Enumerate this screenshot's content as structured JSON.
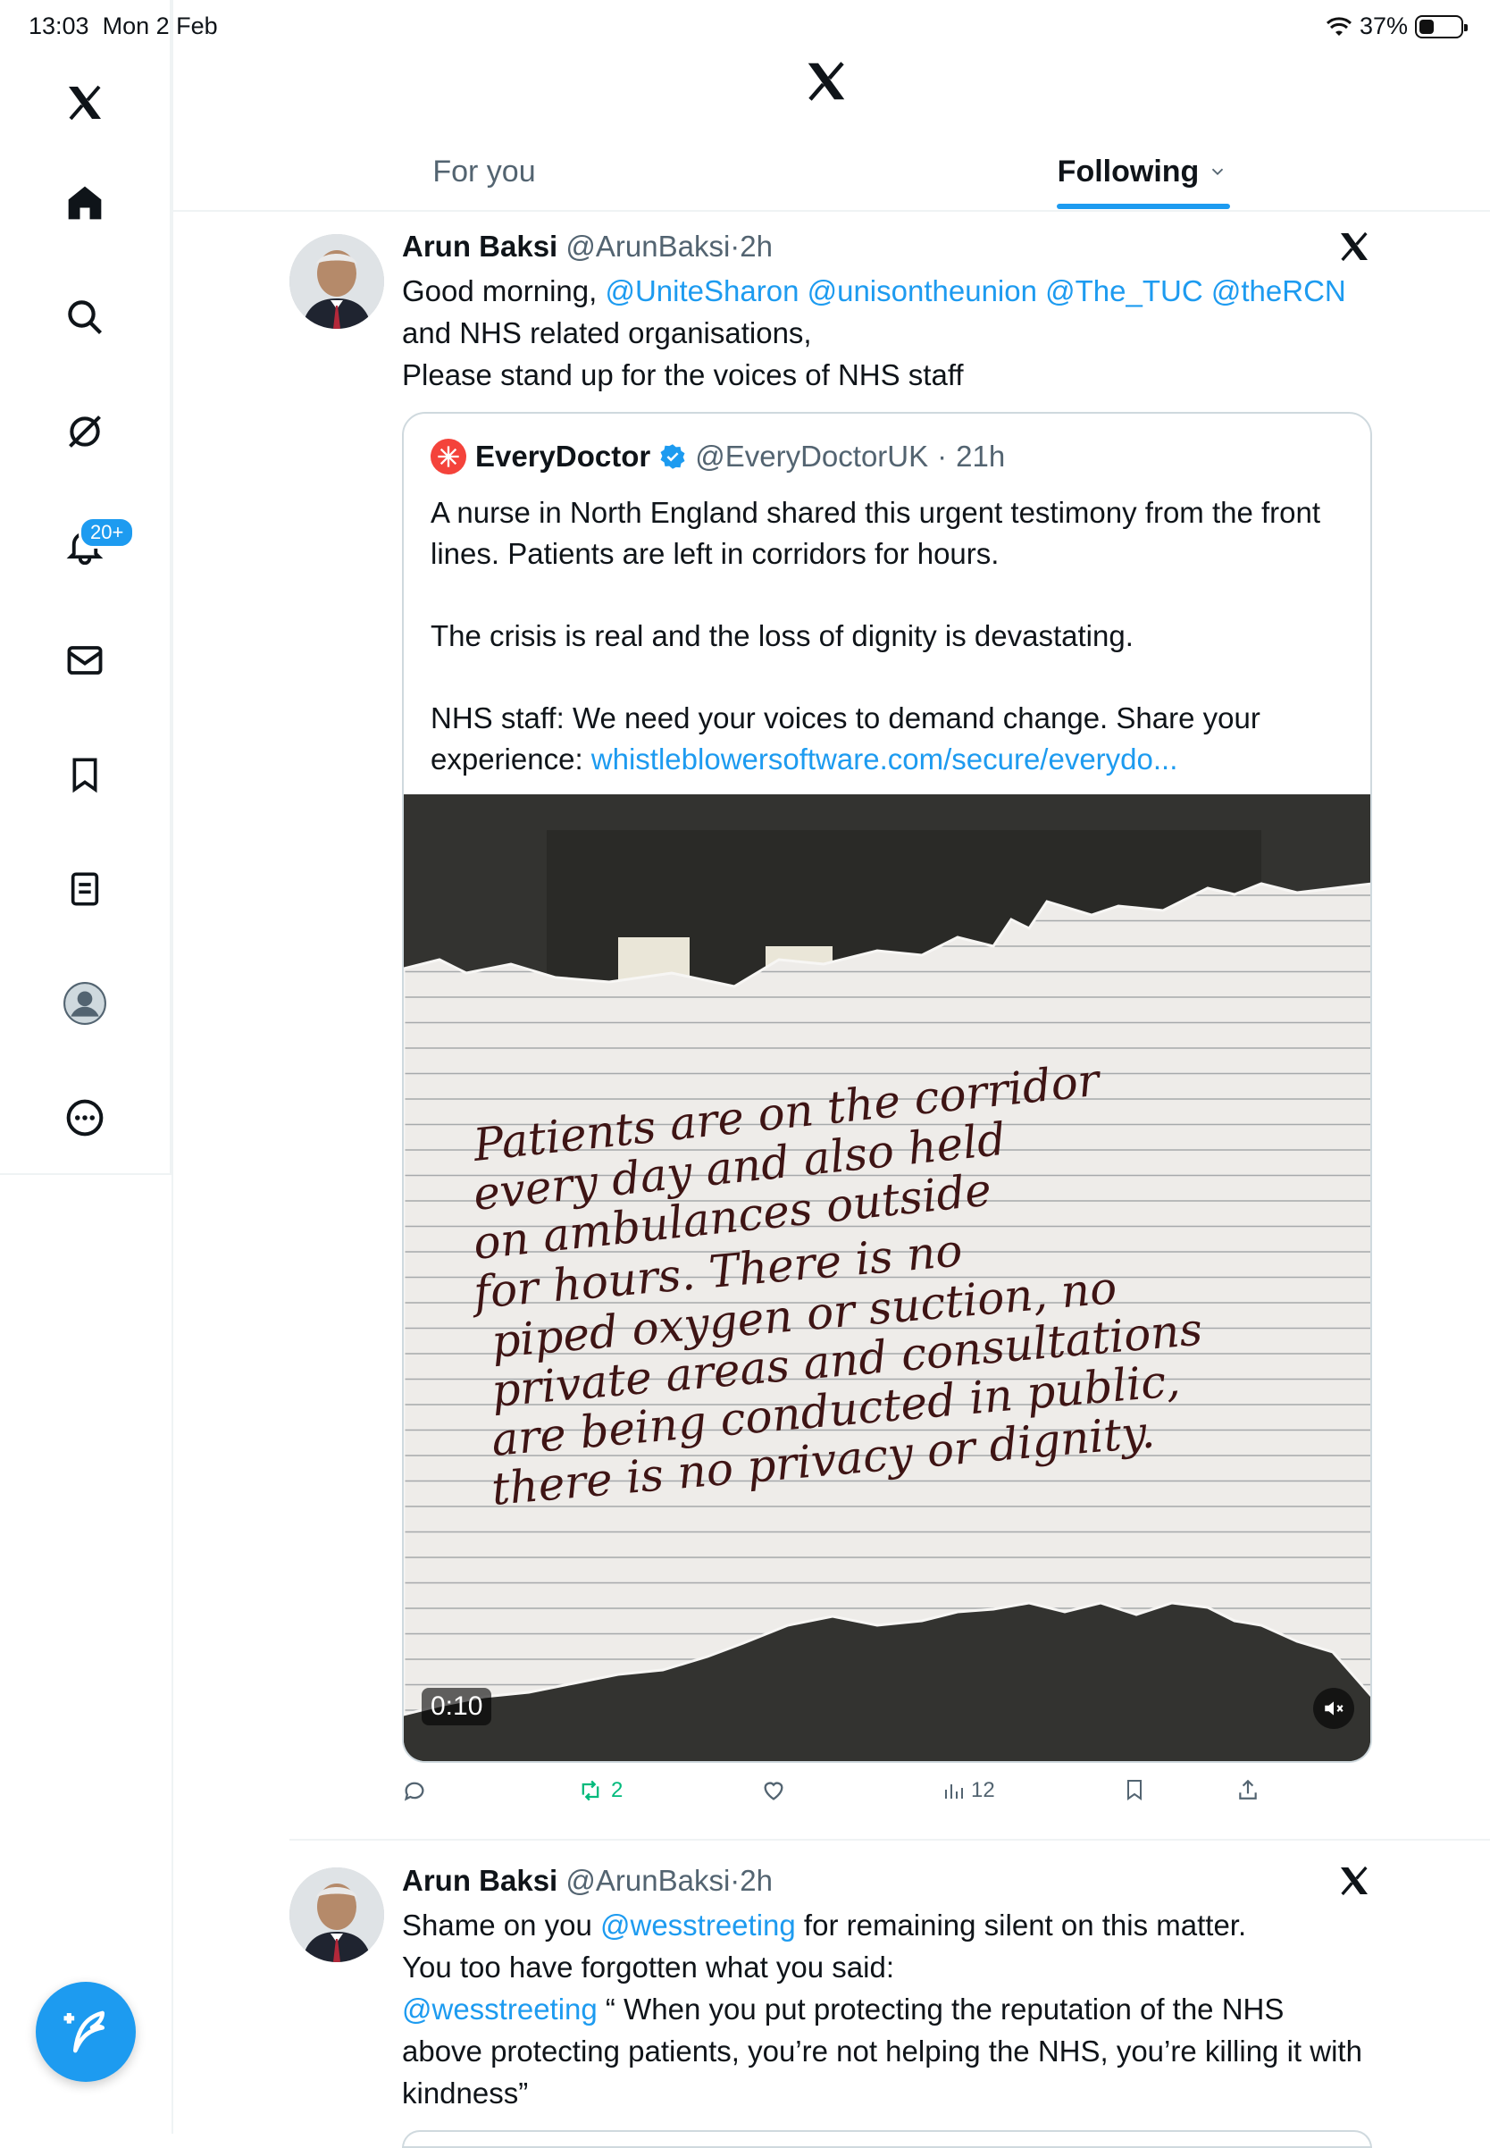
{
  "status_bar": {
    "time": "13:03",
    "date": "Mon 2 Feb",
    "battery": "37%",
    "battery_level": 0.37
  },
  "sidebar": {
    "items": [
      {
        "name": "x-logo-icon"
      },
      {
        "name": "home-icon"
      },
      {
        "name": "search-icon"
      },
      {
        "name": "grok-icon"
      },
      {
        "name": "notifications-icon"
      },
      {
        "name": "messages-icon"
      },
      {
        "name": "bookmarks-icon"
      },
      {
        "name": "lists-icon"
      },
      {
        "name": "profile-icon"
      },
      {
        "name": "more-icon"
      }
    ],
    "notifications_badge": "20+"
  },
  "tabs": {
    "for_you": "For you",
    "following": "Following"
  },
  "tweets": [
    {
      "name": "Arun Baksi",
      "handle": "@ArunBaksi",
      "time": "2h",
      "text_intro": "Good morning, ",
      "mentions": [
        "@UniteSharon",
        "@unisontheunion",
        "@The_TUC",
        "@theRCN"
      ],
      "text_line2": "and NHS related organisations,",
      "text_line3": "Please stand up for the voices of NHS staff",
      "quote": {
        "name": "EveryDoctor",
        "handle": "@EveryDoctorUK",
        "time": "21h",
        "para1": "A nurse in North England shared this urgent testimony from the front lines. Patients are left in corridors for hours.",
        "para2": "The crisis is real and the loss of dignity is devastating.",
        "para3_text": "NHS staff: We need your voices to demand change. Share your experience: ",
        "para3_link": "whistleblowersoftware.com/secure/everydo...",
        "video_duration": "0:10",
        "note_lines": [
          "Patients are on the corridor",
          "every day and also held",
          "on ambulances outside",
          "for hours. There is no",
          "piped oxygen or suction, no",
          "private areas and consultations",
          "are being conducted in public,",
          "there is no privacy or dignity."
        ]
      },
      "actions": {
        "replies": "",
        "reposts": "2",
        "likes": "",
        "views": "12"
      }
    },
    {
      "name": "Arun Baksi",
      "handle": "@ArunBaksi",
      "time": "2h",
      "line1_pre": "Shame on you ",
      "line1_mention": "@wesstreeting",
      "line1_post": " for remaining silent on this matter.",
      "line2": "You too have forgotten what you said:",
      "line3_mention": "@wesstreeting",
      "line3_post": " “ When you put protecting the reputation of the NHS above protecting patients, you’re not helping the NHS, you’re killing it with kindness”"
    }
  ],
  "colors": {
    "accent": "#1d9bf0",
    "repost": "#00ba7c",
    "text": "#0f1419",
    "muted": "#536471"
  }
}
